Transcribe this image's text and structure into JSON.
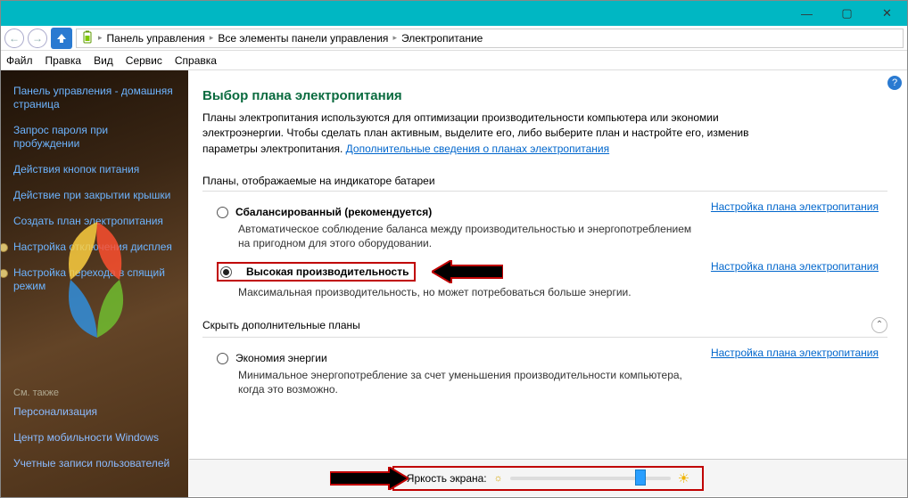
{
  "window_controls": {
    "min": "—",
    "max": "▢",
    "close": "✕"
  },
  "breadcrumbs": {
    "sep": "▸",
    "items": [
      "Панель управления",
      "Все элементы панели управления",
      "Электропитание"
    ]
  },
  "menu": {
    "file": "Файл",
    "edit": "Правка",
    "view": "Вид",
    "service": "Сервис",
    "help": "Справка"
  },
  "sidebar": {
    "home": "Панель управления - домашняя страница",
    "links": [
      "Запрос пароля при пробуждении",
      "Действия кнопок питания",
      "Действие при закрытии крышки",
      "Создать план электропитания",
      "Настройка отключения дисплея",
      "Настройка перехода в спящий режим"
    ],
    "see_also": "См. также",
    "bottom": [
      "Персонализация",
      "Центр мобильности Windows",
      "Учетные записи пользователей"
    ]
  },
  "page": {
    "title": "Выбор плана электропитания",
    "intro_main": "Планы электропитания используются для оптимизации производительности компьютера или экономии электроэнергии. Чтобы сделать план активным, выделите его, либо выберите план и настройте его, изменив параметры электропитания. ",
    "intro_link": "Дополнительные сведения о планах электропитания",
    "section_shown": "Планы, отображаемые на индикаторе батареи",
    "section_hidden": "Скрыть дополнительные планы",
    "configure": "Настройка плана электропитания",
    "plans": {
      "balanced": {
        "label": "Сбалансированный (рекомендуется)",
        "desc": "Автоматическое соблюдение баланса между производительностью и энергопотреблением на пригодном для этого оборудовании."
      },
      "high": {
        "label": "Высокая производительность",
        "desc": "Максимальная производительность, но может потребоваться больше энергии."
      },
      "eco": {
        "label": "Экономия энергии",
        "desc": "Минимальное энергопотребление за счет уменьшения производительности компьютера, когда это возможно."
      }
    },
    "brightness_label": "Яркость экрана:"
  },
  "chart_data": null
}
